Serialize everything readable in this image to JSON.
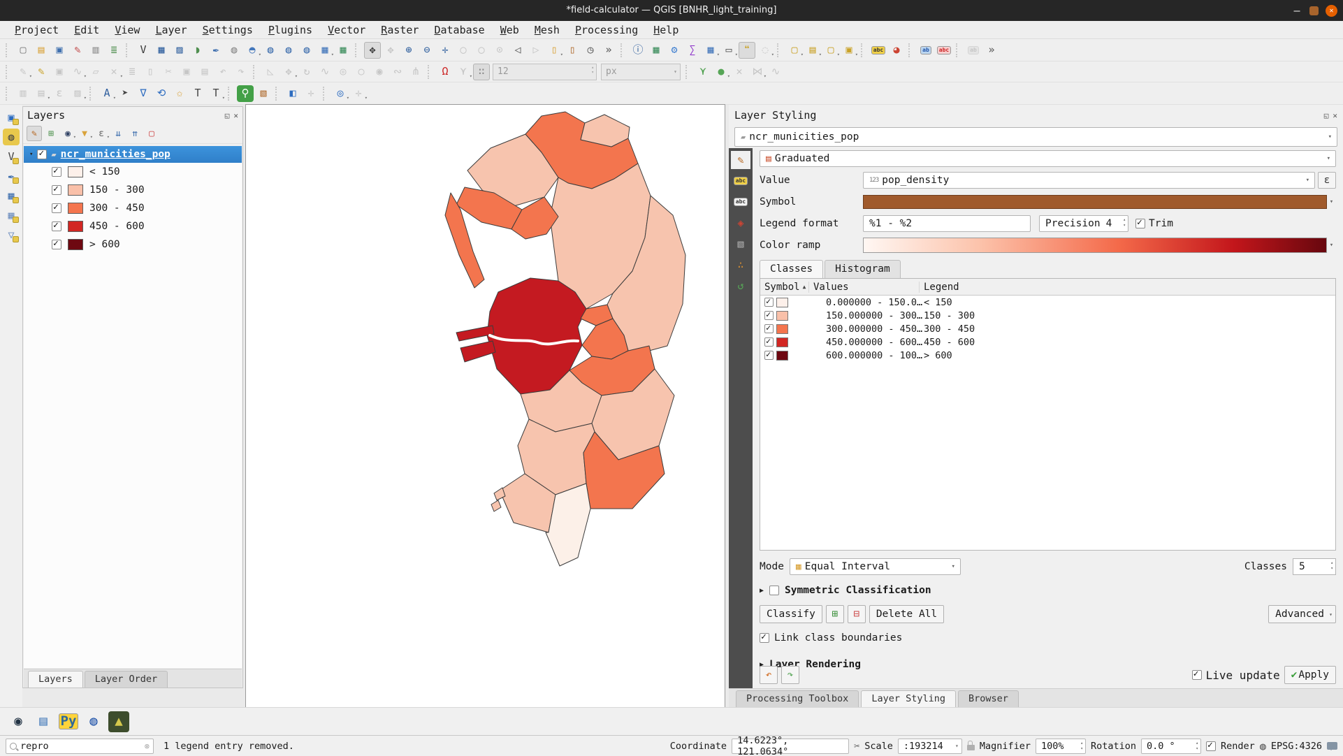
{
  "window": {
    "title": "*field-calculator — QGIS [BNHR_light_training]"
  },
  "menubar": [
    "Project",
    "Edit",
    "View",
    "Layer",
    "Settings",
    "Plugins",
    "Vector",
    "Raster",
    "Database",
    "Web",
    "Mesh",
    "Processing",
    "Help"
  ],
  "toolbar_row1": [
    {
      "s": 1
    },
    {
      "n": "new-project-icon",
      "g": "▢",
      "c": "#7a7a7a"
    },
    {
      "n": "open-project-icon",
      "g": "▤",
      "c": "#d9a33c"
    },
    {
      "n": "save-project-icon",
      "g": "▣",
      "c": "#3f6fae"
    },
    {
      "n": "style-manager-icon",
      "g": "✎",
      "c": "#c04848"
    },
    {
      "n": "print-layout-icon",
      "g": "▥",
      "c": "#8a8a8a"
    },
    {
      "n": "new-report-icon",
      "g": "≣",
      "c": "#4f8f4f"
    },
    {
      "s": 1
    },
    {
      "n": "new-vector-layer-icon",
      "g": "V",
      "c": "#3a3a3a"
    },
    {
      "n": "raster-calculator-icon",
      "g": "▦",
      "c": "#2f5f9e"
    },
    {
      "n": "mesh-calculator-icon",
      "g": "▨",
      "c": "#2f5f9e"
    },
    {
      "n": "new-geopackage-icon",
      "g": "◗",
      "c": "#4f8f4f"
    },
    {
      "n": "new-shapefile-icon",
      "g": "✒",
      "c": "#3f6fae"
    },
    {
      "n": "new-spatialite-icon",
      "g": "◍",
      "c": "#8a8a8a"
    },
    {
      "n": "add-postgis-icon",
      "g": "◓",
      "c": "#4477bb",
      "v": 1
    },
    {
      "n": "add-wms-layer-icon",
      "g": "◍",
      "c": "#3f6fae"
    },
    {
      "n": "add-arcgis-layer-icon",
      "g": "◍",
      "c": "#3f6fae"
    },
    {
      "n": "add-wfs-layer-icon",
      "g": "◍",
      "c": "#3f6fae"
    },
    {
      "n": "add-virtual-layer-icon",
      "g": "▦",
      "c": "#4477bb",
      "v": 1
    },
    {
      "n": "add-delimited-text-icon",
      "g": "▦",
      "c": "#3f8f5f"
    },
    {
      "s": 1
    },
    {
      "n": "pan-map-icon",
      "g": "✥",
      "c": "#333333",
      "a": 1
    },
    {
      "n": "pan-to-selection-icon",
      "g": "✥",
      "d": 1
    },
    {
      "n": "zoom-in-icon",
      "g": "⊕",
      "c": "#2f5f9e"
    },
    {
      "n": "zoom-out-icon",
      "g": "⊖",
      "c": "#2f5f9e"
    },
    {
      "n": "zoom-full-icon",
      "g": "✛",
      "c": "#2f5f9e"
    },
    {
      "n": "zoom-to-selection-icon",
      "g": "◯",
      "d": 1
    },
    {
      "n": "zoom-to-layer-icon",
      "g": "◯",
      "d": 1
    },
    {
      "n": "zoom-native-icon",
      "g": "⊙",
      "d": 1
    },
    {
      "n": "zoom-last-icon",
      "g": "◁",
      "c": "#555555"
    },
    {
      "n": "zoom-next-icon",
      "g": "▷",
      "d": 1
    },
    {
      "n": "new-bookmark-icon",
      "g": "▯",
      "c": "#d9a33c",
      "v": 1
    },
    {
      "n": "show-bookmarks-icon",
      "g": "▯",
      "c": "#b06c2f"
    },
    {
      "n": "temporal-controller-icon",
      "g": "◷",
      "c": "#555555"
    },
    {
      "n": "toolbar-overflow-icon",
      "g": "»",
      "c": "#555555"
    },
    {
      "s": 1
    },
    {
      "n": "identify-features-icon",
      "g": "ⓘ",
      "c": "#2f5f9e"
    },
    {
      "n": "statistical-summary-icon",
      "g": "▦",
      "c": "#3f8f5f"
    },
    {
      "n": "processing-toolbox-icon",
      "g": "⚙",
      "c": "#3f7fd0"
    },
    {
      "n": "sum-features-icon",
      "g": "∑",
      "c": "#8b2fc9"
    },
    {
      "n": "field-calculator-icon",
      "g": "▦",
      "c": "#4477bb",
      "v": 1
    },
    {
      "n": "measure-icon",
      "g": "▭",
      "c": "#555555",
      "v": 1
    },
    {
      "n": "map-tips-icon",
      "g": "❝",
      "c": "#c9a227",
      "a": 1
    },
    {
      "n": "nominatim-search-icon",
      "g": "◌",
      "d": 1,
      "v": 1
    },
    {
      "s": 1
    },
    {
      "n": "select-features-icon",
      "g": "▢",
      "c": "#c9a227",
      "v": 1
    },
    {
      "n": "select-by-value-icon",
      "g": "▤",
      "c": "#c9a227",
      "v": 1
    },
    {
      "n": "deselect-features-icon",
      "g": "▢",
      "c": "#c9a227",
      "v": 1
    },
    {
      "n": "select-all-icon",
      "g": "▣",
      "c": "#c9a227",
      "v": 1
    },
    {
      "s": 1
    },
    {
      "n": "layer-labeling-icon",
      "g": "abc",
      "p": "#f0d048",
      "c": "#333333"
    },
    {
      "n": "layer-diagram-icon",
      "g": "◕",
      "c": "#cc4433"
    },
    {
      "s": 1
    },
    {
      "n": "pin-labels-icon",
      "g": "ab",
      "p": "#bcd6f0",
      "c": "#2255aa"
    },
    {
      "n": "highlight-labels-icon",
      "g": "abc",
      "p": "#f8d0d0",
      "c": "#cc2222"
    },
    {
      "s": 1
    },
    {
      "n": "label-extra-icon",
      "g": "ab",
      "p": "#e4e4e4",
      "d": 1
    },
    {
      "n": "toolbar-overflow2-icon",
      "g": "»",
      "c": "#555555"
    }
  ],
  "toolbar_row2": [
    {
      "s": 1
    },
    {
      "n": "current-edits-icon",
      "g": "✎",
      "d": 1,
      "v": 1
    },
    {
      "n": "toggle-editing-icon",
      "g": "✎",
      "c": "#c9a227"
    },
    {
      "n": "save-edits-icon",
      "g": "▣",
      "d": 1
    },
    {
      "n": "digitize-icon",
      "g": "∿",
      "d": 1,
      "v": 1
    },
    {
      "n": "add-record-icon",
      "g": "▱",
      "d": 1
    },
    {
      "n": "vertex-tool-icon",
      "g": "✕",
      "d": 1,
      "v": 1
    },
    {
      "n": "multiedit-icon",
      "g": "≣",
      "d": 1
    },
    {
      "n": "delete-selected-icon",
      "g": "▯",
      "d": 1
    },
    {
      "n": "cut-features-icon",
      "g": "✂",
      "d": 1
    },
    {
      "n": "copy-features-icon",
      "g": "▣",
      "d": 1
    },
    {
      "n": "paste-features-icon",
      "g": "▤",
      "d": 1
    },
    {
      "n": "undo-icon",
      "g": "↶",
      "d": 1
    },
    {
      "n": "redo-icon",
      "g": "↷",
      "d": 1
    },
    {
      "s": 1
    },
    {
      "n": "measure-angle-icon",
      "g": "◺",
      "d": 1
    },
    {
      "n": "move-feature-icon",
      "g": "✥",
      "d": 1,
      "v": 1
    },
    {
      "n": "rotate-feature-icon",
      "g": "↻",
      "d": 1
    },
    {
      "n": "simplify-feature-icon",
      "g": "∿",
      "d": 1
    },
    {
      "n": "add-ring-icon",
      "g": "◎",
      "d": 1
    },
    {
      "n": "add-part-icon",
      "g": "○",
      "d": 1
    },
    {
      "n": "fill-ring-icon",
      "g": "◉",
      "d": 1
    },
    {
      "n": "offset-curve-icon",
      "g": "∾",
      "d": 1
    },
    {
      "n": "reshape-icon",
      "g": "⋔",
      "d": 1
    },
    {
      "s": 1
    },
    {
      "n": "snapping-icon",
      "g": "Ω",
      "c": "#cc2222"
    },
    {
      "n": "tracing-icon",
      "g": "⋎",
      "d": 1,
      "v": 1
    },
    {
      "n": "advanced-digitizing-icon",
      "g": "∷",
      "c": "#888888",
      "a": 1
    },
    {
      "n": "stroke-width-spinner",
      "spin": "12"
    },
    {
      "n": "stroke-unit-combo",
      "combo": "px"
    },
    {
      "s": 1
    },
    {
      "n": "tracing-config-icon",
      "g": "⋎",
      "c": "#4a9e4a"
    },
    {
      "n": "shape-digitize-icon",
      "g": "●",
      "c": "#56a556",
      "v": 1
    },
    {
      "n": "delete-vertex-icon",
      "g": "✕",
      "d": 1
    },
    {
      "n": "flip-line-icon",
      "g": "⋈",
      "d": 1,
      "v": 1
    },
    {
      "n": "curve-digitize-icon",
      "g": "∿",
      "d": 1
    }
  ],
  "toolbar_row3": [
    {
      "s": 1
    },
    {
      "n": "attributes-form-icon",
      "g": "▥",
      "d": 1
    },
    {
      "n": "form-selection-icon",
      "g": "▤",
      "d": 1,
      "v": 1
    },
    {
      "n": "expression-select-icon",
      "g": "ε",
      "d": 1
    },
    {
      "n": "form-box-icon",
      "g": "▨",
      "d": 1,
      "v": 1
    },
    {
      "s": 1
    },
    {
      "n": "auto-label-icon",
      "g": "A",
      "c": "#2f5f9e",
      "v": 1
    },
    {
      "n": "label-cursor-icon",
      "g": "➤",
      "c": "#444444"
    },
    {
      "n": "move-label-icon",
      "g": "∇",
      "c": "#2d6cc0"
    },
    {
      "n": "rotate-label-icon",
      "g": "⟲",
      "c": "#2d6cc0"
    },
    {
      "n": "pinned-labels-icon",
      "g": "✩",
      "c": "#d9a33c"
    },
    {
      "n": "add-text-icon",
      "g": "T",
      "c": "#444444"
    },
    {
      "n": "text-annotation-icon",
      "g": "T",
      "c": "#444444",
      "v": 1
    },
    {
      "s": 1
    },
    {
      "n": "osm-search-icon",
      "g": "⚲",
      "c": "#ffffff",
      "bg": "#43a047"
    },
    {
      "n": "quickmap-services-icon",
      "g": "▧",
      "c": "#b06c2f"
    },
    {
      "s": 1
    },
    {
      "n": "decoration-icon",
      "g": "◧",
      "c": "#2d6cc0"
    },
    {
      "n": "north-arrow-icon",
      "g": "✛",
      "d": 1
    },
    {
      "s": 1
    },
    {
      "n": "georeferencer-icon",
      "g": "◎",
      "c": "#2d6cc0",
      "v": 1
    },
    {
      "n": "gps-tools-icon",
      "g": "✛",
      "d": 1,
      "v": 1
    }
  ],
  "left_dock": [
    {
      "n": "data-source-manager-icon",
      "g": "▣",
      "c": "#2d6cc0",
      "badge": 1
    },
    {
      "n": "web-catalog-icon",
      "g": "◍",
      "c": "#444444",
      "bg": "#e8c84c"
    },
    {
      "n": "new-vector-dock-icon",
      "g": "V",
      "c": "#444444",
      "badge": 1
    },
    {
      "n": "new-shapefile-dock-icon",
      "g": "✒",
      "c": "#3f6fae",
      "badge": 1
    },
    {
      "n": "virtual-layer-dock-icon",
      "g": "▦",
      "c": "#3f6fae",
      "badge": 1
    },
    {
      "n": "raster-dock-icon",
      "g": "▦",
      "c": "#6f8fbf",
      "badge": 1
    },
    {
      "n": "mesh-dock-icon",
      "g": "▽",
      "c": "#6f8fbf",
      "badge": 1
    }
  ],
  "layers_panel": {
    "title": "Layers",
    "toolbar": [
      {
        "n": "open-layer-styling-panel-icon",
        "g": "✎",
        "c": "#b5651d",
        "a": 1
      },
      {
        "n": "add-group-icon",
        "g": "⊞",
        "c": "#4a8f4a"
      },
      {
        "n": "manage-visibility-icon",
        "g": "◉",
        "c": "#334466",
        "v": 1
      },
      {
        "n": "filter-legend-icon",
        "g": "▼",
        "c": "#d9a33c",
        "v": 1
      },
      {
        "n": "filter-expression-icon",
        "g": "ε",
        "c": "#666666",
        "v": 1
      },
      {
        "n": "expand-all-icon",
        "g": "⇊",
        "c": "#3f6fae"
      },
      {
        "n": "collapse-all-icon",
        "g": "⇈",
        "c": "#3f6fae"
      },
      {
        "n": "remove-layer-icon",
        "g": "▢",
        "c": "#cc4444"
      }
    ],
    "layer_name": "ncr_municities_pop",
    "classes": [
      {
        "label": "< 150",
        "color": "#fdf0ea"
      },
      {
        "label": "150 - 300",
        "color": "#f9c0a9"
      },
      {
        "label": "300 - 450",
        "color": "#f4754e"
      },
      {
        "label": "450 - 600",
        "color": "#d22723"
      },
      {
        "label": "> 600",
        "color": "#6e0811"
      }
    ],
    "bottom_tabs": {
      "layers": "Layers",
      "layer_order": "Layer Order"
    }
  },
  "styling_panel": {
    "title": "Layer Styling",
    "layer_selector": "ncr_municities_pop",
    "renderer": "Graduated",
    "value_label": "Value",
    "value_prefix": "123",
    "value": "pop_density",
    "expression_icon": "ε",
    "symbol_label": "Symbol",
    "symbol_color": "#a05a2c",
    "legend_format_label": "Legend format",
    "legend_format": "%1 - %2",
    "precision_label": "Precision",
    "precision": "4",
    "trim_label": "Trim",
    "color_ramp_label": "Color ramp",
    "tabs": {
      "classes": "Classes",
      "histogram": "Histogram"
    },
    "table": {
      "headers": {
        "symbol": "Symbol",
        "values": "Values",
        "legend": "Legend"
      },
      "rows": [
        {
          "values": "0.000000 - 150.0…",
          "legend": "< 150",
          "color": "#fdf0ea"
        },
        {
          "values": "150.000000 - 300…",
          "legend": "150 - 300",
          "color": "#f9c0a9"
        },
        {
          "values": "300.000000 - 450…",
          "legend": "300 - 450",
          "color": "#f4754e"
        },
        {
          "values": "450.000000 - 600…",
          "legend": "450 - 600",
          "color": "#d22723"
        },
        {
          "values": "600.000000 - 100…",
          "legend": "> 600",
          "color": "#6e0811"
        }
      ]
    },
    "mode_label": "Mode",
    "mode": "Equal Interval",
    "classes_label": "Classes",
    "classes_count": "5",
    "symmetric_label": "Symmetric Classification",
    "classify_label": "Classify",
    "delete_all_label": "Delete All",
    "advanced_label": "Advanced",
    "link_label": "Link class boundaries",
    "layer_rendering_label": "Layer Rendering",
    "live_update_label": "Live update",
    "apply_label": "Apply",
    "strip_icons": [
      {
        "n": "symbology-tab-icon",
        "g": "✎",
        "c": "#b5651d",
        "a": 1
      },
      {
        "n": "labels-tab-icon",
        "g": "abc",
        "p": "#f0d048",
        "c": "#333333"
      },
      {
        "n": "callouts-tab-icon",
        "g": "abc",
        "p": "#f5f5f5",
        "c": "#333333"
      },
      {
        "n": "view-3d-tab-icon",
        "g": "◈",
        "c": "#cc4433"
      },
      {
        "n": "masks-tab-icon",
        "g": "▧",
        "c": "#aaaaaa"
      },
      {
        "n": "diagrams-tab-icon",
        "g": "∴",
        "c": "#cc8833"
      },
      {
        "n": "history-tab-icon",
        "g": "↺",
        "c": "#56a556"
      }
    ],
    "bottom_tabs": {
      "processing": "Processing Toolbox",
      "styling": "Layer Styling",
      "browser": "Browser"
    }
  },
  "plugin_bar": [
    {
      "n": "metasearch-icon",
      "g": "◉",
      "c": "#223344"
    },
    {
      "n": "db-manager-icon",
      "g": "▤",
      "c": "#4a7ebb"
    },
    {
      "n": "python-console-icon",
      "g": "Py",
      "p": "#ffd43b",
      "c": "#306998"
    },
    {
      "n": "osm-globe-icon",
      "g": "◍",
      "c": "#2255aa"
    },
    {
      "n": "mesh-plugin-icon",
      "g": "▲",
      "c": "#d4c84c",
      "bg": "#3d4d2d"
    }
  ],
  "statusbar": {
    "search_value": "repro",
    "message": "1 legend entry removed.",
    "coordinate_label": "Coordinate",
    "coordinate_value": "14.6223°, 121.0634°",
    "scale_label": "Scale",
    "scale_value": ":193214",
    "magnifier_label": "Magnifier",
    "magnifier_value": "100%",
    "rotation_label": "Rotation",
    "rotation_value": "0.0 °",
    "render_label": "Render",
    "epsg_label": "EPSG:4326"
  },
  "map": {
    "class_colors": {
      "c1": "#fcf0e8",
      "c2": "#f7c4ae",
      "c3": "#f3754e",
      "c4": "#c41a21"
    },
    "outline": "#3c3c3c"
  }
}
